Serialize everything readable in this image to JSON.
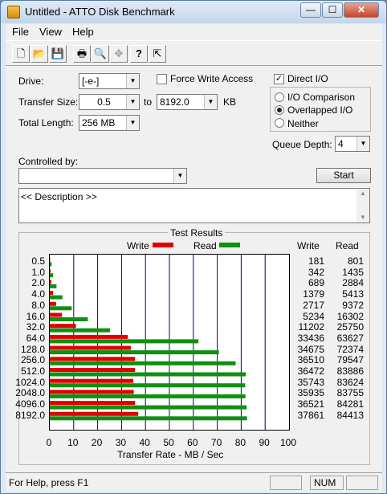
{
  "window": {
    "title": "Untitled - ATTO Disk Benchmark",
    "minimize": "—",
    "maximize": "☐",
    "close": "✕"
  },
  "menu": [
    "File",
    "View",
    "Help"
  ],
  "toolbar": {
    "icons": [
      "new-icon",
      "open-icon",
      "save-icon",
      "print-icon",
      "print-preview-icon",
      "move-icon",
      "help-icon",
      "context-help-icon"
    ],
    "glyphs": [
      "🗋",
      "📂",
      "💾",
      "🖶",
      "🔍",
      "✥",
      "?",
      "⇱"
    ]
  },
  "form": {
    "drive_label": "Drive:",
    "drive_value": "[-e-]",
    "force_write_label": "Force Write Access",
    "direct_io_label": "Direct I/O",
    "direct_io_checked": true,
    "transfer_size_label": "Transfer Size:",
    "transfer_from": "0.5",
    "to_label": "to",
    "transfer_to": "8192.0",
    "kb_label": "KB",
    "total_length_label": "Total Length:",
    "total_length": "256 MB",
    "io_comparison_label": "I/O Comparison",
    "overlapped_io_label": "Overlapped I/O",
    "neither_label": "Neither",
    "queue_depth_label": "Queue Depth:",
    "queue_depth": "4",
    "controlled_by_label": "Controlled by:",
    "controlled_by_value": "",
    "start_label": "Start",
    "description": "<< Description >>",
    "check_mark": "✓",
    "arrow_down": "▼",
    "arrow_up": "▲"
  },
  "results": {
    "group_title": "Test Results",
    "legend_write": "Write",
    "legend_read": "Read",
    "col_write": "Write",
    "col_read": "Read"
  },
  "colors": {
    "write": "#e00000",
    "read": "#109010",
    "grid": "#000080"
  },
  "chart_data": {
    "type": "bar",
    "orientation": "horizontal",
    "categories": [
      "0.5",
      "1.0",
      "2.0",
      "4.0",
      "8.0",
      "16.0",
      "32.0",
      "64.0",
      "128.0",
      "256.0",
      "512.0",
      "1024.0",
      "2048.0",
      "4096.0",
      "8192.0"
    ],
    "series": [
      {
        "name": "Write",
        "values_kb_s": [
          181,
          342,
          689,
          1379,
          2717,
          5234,
          11202,
          33436,
          34675,
          36510,
          36472,
          35743,
          35935,
          36521,
          37861
        ]
      },
      {
        "name": "Read",
        "values_kb_s": [
          801,
          1435,
          2884,
          5413,
          9372,
          16302,
          25750,
          63627,
          72374,
          79547,
          83886,
          83624,
          83755,
          84281,
          84413
        ]
      }
    ],
    "xlabel": "Transfer Rate - MB / Sec",
    "xticks": [
      "0",
      "10",
      "20",
      "30",
      "40",
      "50",
      "60",
      "70",
      "80",
      "90",
      "100"
    ],
    "xlim": [
      0,
      100
    ],
    "grid": true,
    "legend": "top"
  },
  "status": {
    "help_text": "For Help, press F1",
    "num": "NUM"
  }
}
